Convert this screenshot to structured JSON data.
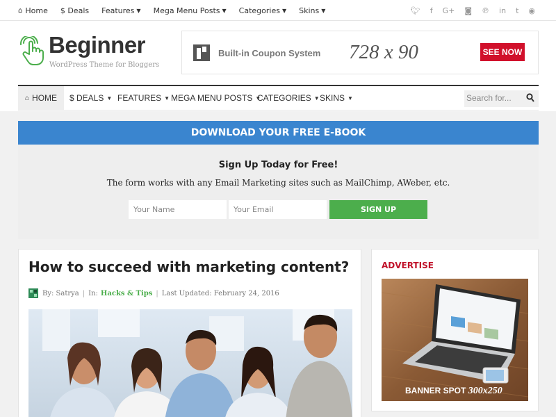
{
  "topbar": {
    "items": [
      {
        "label": "Home",
        "icon": "home-icon"
      },
      {
        "label": "$ Deals"
      },
      {
        "label": "Features"
      },
      {
        "label": "Mega Menu Posts"
      },
      {
        "label": "Categories"
      },
      {
        "label": "Skins"
      }
    ],
    "social": [
      "twitter-icon",
      "facebook-icon",
      "google-plus-icon",
      "instagram-icon",
      "pinterest-icon",
      "linkedin-icon",
      "tumblr-icon",
      "rss-icon"
    ]
  },
  "header": {
    "title": "Beginner",
    "tagline": "WordPress Theme for Bloggers",
    "ad": {
      "text": "Built-in Coupon System",
      "size": "728 x 90",
      "cta": "SEE NOW"
    }
  },
  "mainnav": {
    "items": [
      {
        "label": "HOME"
      },
      {
        "label": "$ DEALS"
      },
      {
        "label": "FEATURES"
      },
      {
        "label": "MEGA MENU POSTS"
      },
      {
        "label": "CATEGORIES"
      },
      {
        "label": "SKINS"
      }
    ],
    "search_placeholder": "Search for..."
  },
  "optin": {
    "bar": "DOWNLOAD YOUR FREE E-BOOK",
    "heading": "Sign Up Today for Free!",
    "text": "The form works with any Email Marketing sites such as MailChimp, AWeber, etc.",
    "name_placeholder": "Your Name",
    "email_placeholder": "Your Email",
    "button": "SIGN UP"
  },
  "post": {
    "title": "How to succeed with marketing content?",
    "by_label": "By: Satrya",
    "in_label": "In:",
    "category": "Hacks & Tips",
    "updated": "Last Updated: February 24, 2016"
  },
  "sidebar": {
    "title": "ADVERTISE",
    "banner_label": "BANNER SPOT",
    "banner_size": "300x250"
  },
  "colors": {
    "accent_blue": "#3a85cf",
    "accent_green": "#4cae4c",
    "accent_red": "#d1102b"
  }
}
